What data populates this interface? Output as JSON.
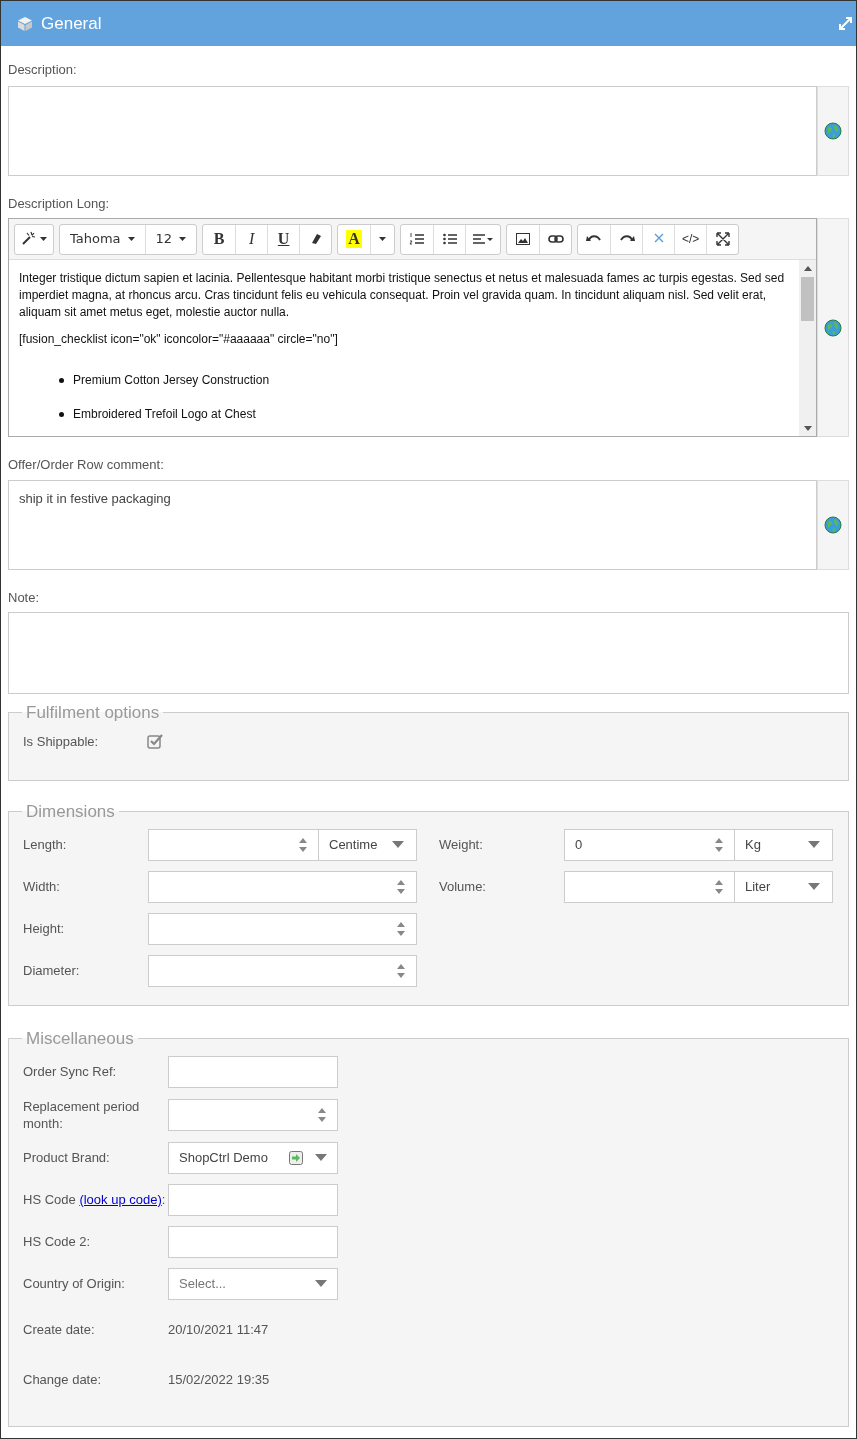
{
  "panel": {
    "title": "General"
  },
  "description": {
    "label": "Description:",
    "translatable": true
  },
  "description_long": {
    "label": "Description Long:",
    "translatable": true,
    "toolbar": [
      [
        {
          "kind": "magic"
        }
      ],
      [
        {
          "kind": "font",
          "text": "Tahoma"
        },
        {
          "kind": "size",
          "text": "12"
        }
      ],
      [
        {
          "kind": "bold",
          "text": "B"
        },
        {
          "kind": "italic",
          "text": "I"
        },
        {
          "kind": "underline",
          "text": "U"
        },
        {
          "kind": "eraser"
        }
      ],
      [
        {
          "kind": "color",
          "text": "A"
        },
        {
          "kind": "caret"
        }
      ],
      [
        {
          "kind": "ol"
        },
        {
          "kind": "ul"
        },
        {
          "kind": "align"
        }
      ],
      [
        {
          "kind": "picture"
        },
        {
          "kind": "link"
        }
      ],
      [
        {
          "kind": "undo"
        },
        {
          "kind": "redo"
        },
        {
          "kind": "clear"
        },
        {
          "kind": "code",
          "text": "</>"
        },
        {
          "kind": "fullscreen"
        }
      ]
    ],
    "paragraphs": [
      "Integer tristique dictum sapien et lacinia. Pellentesque habitant morbi tristique senectus et netus et malesuada fames ac turpis egestas. Sed sed imperdiet magna, at rhoncus arcu. Cras tincidunt felis eu vehicula consequat. Proin vel gravida quam. In tincidunt aliquam nisl. Sed velit erat, aliquam sit amet metus eget, molestie auctor nulla.",
      "[fusion_checklist icon=\"ok\" iconcolor=\"#aaaaaa\" circle=\"no\"]"
    ],
    "bullets": [
      "Premium Cotton Jersey Construction",
      "Embroidered Trefoil Logo at Chest"
    ]
  },
  "offer_comment": {
    "label": "Offer/Order Row comment:",
    "value": "ship it in festive packaging",
    "translatable": true
  },
  "note": {
    "label": "Note:"
  },
  "fulfilment": {
    "legend": "Fulfilment options",
    "fields": [
      {
        "label": "Is Shippable:",
        "checked": true
      }
    ]
  },
  "dimensions": {
    "legend": "Dimensions",
    "left": [
      {
        "label": "Length:",
        "unit": "Centime"
      },
      {
        "label": "Width:"
      },
      {
        "label": "Height:"
      },
      {
        "label": "Diameter:"
      }
    ],
    "right": [
      {
        "label": "Weight:",
        "value": "0",
        "unit": "Kg"
      },
      {
        "label": "Volume:",
        "unit": "Liter"
      }
    ]
  },
  "miscellaneous": {
    "legend": "Miscellaneous",
    "fields": [
      {
        "kind": "text",
        "label": "Order Sync Ref:"
      },
      {
        "kind": "number",
        "label": "Replacement period month:"
      },
      {
        "kind": "brand",
        "label": "Product Brand:",
        "value": "ShopCtrl Demo"
      },
      {
        "kind": "text",
        "label": "HS Code",
        "link": "(look up code)",
        "suffix": ":"
      },
      {
        "kind": "text",
        "label": "HS Code 2:"
      },
      {
        "kind": "select",
        "label": "Country of Origin:",
        "placeholder": "Select..."
      },
      {
        "kind": "readonly",
        "label": "Create date:",
        "value": "20/10/2021 11:47"
      },
      {
        "kind": "readonly",
        "label": "Change date:",
        "value": "15/02/2022 19:35"
      }
    ]
  }
}
